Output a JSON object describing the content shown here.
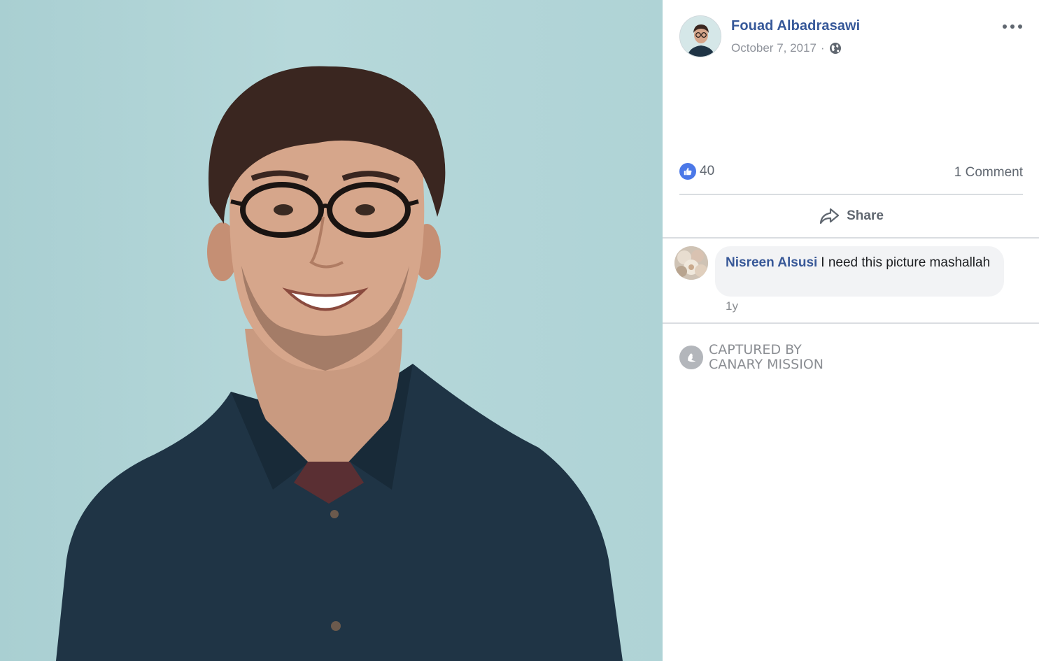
{
  "post": {
    "author_name": "Fouad Albadrasawi",
    "date": "October 7, 2017",
    "separator": "·",
    "privacy_icon": "globe-icon",
    "more_icon": "more-options-icon"
  },
  "engagement": {
    "like_icon": "thumbs-up-icon",
    "like_count": "40",
    "comment_count_label": "1 Comment",
    "share_icon": "share-arrow-icon",
    "share_label": "Share"
  },
  "comments": [
    {
      "author": "Nisreen Alsusi",
      "text": "I need this picture mashallah",
      "time": "1y"
    }
  ],
  "watermark": {
    "icon": "canary-bird-icon",
    "line1": "CAPTURED BY",
    "line2": "CANARY MISSION"
  },
  "colors": {
    "link_blue": "#365899",
    "like_blue": "#4b78e8",
    "photo_background": "#b2d5d8",
    "shirt": "#1f3445"
  }
}
